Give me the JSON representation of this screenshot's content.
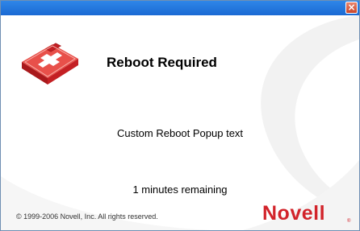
{
  "window": {
    "close_glyph": "×",
    "colors": {
      "titlebar": "#1f74de",
      "close_button": "#d35a3f",
      "brand_red": "#d2232a"
    }
  },
  "dialog": {
    "icon": "first-aid-kit-icon",
    "heading": "Reboot Required",
    "message": "Custom Reboot Popup text",
    "countdown": "1 minutes remaining"
  },
  "footer": {
    "copyright": "© 1999-2006 Novell, Inc. All rights reserved.",
    "brand": "Novell",
    "brand_mark": "®"
  }
}
